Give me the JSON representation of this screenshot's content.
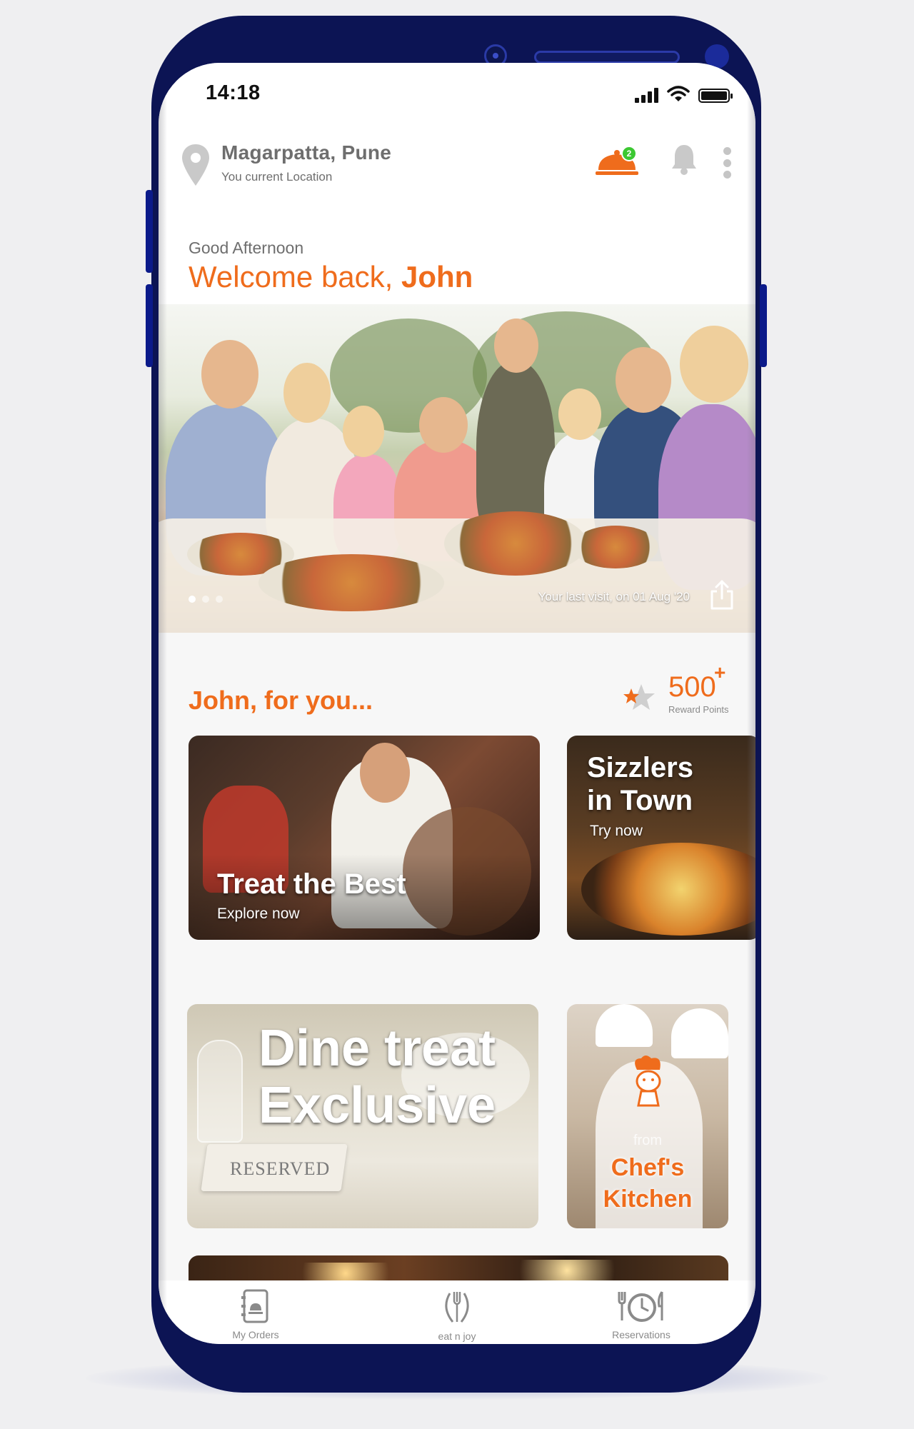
{
  "status_bar": {
    "time": "14:18"
  },
  "location": {
    "title": "Magarpatta, Pune",
    "subtitle": "You current Location"
  },
  "header": {
    "orders_badge": "2"
  },
  "greeting": {
    "line1": "Good Afternoon",
    "welcome_prefix": "Welcome back, ",
    "name": "John"
  },
  "hero": {
    "last_visit": "Your last visit, on 01 Aug '20",
    "dot_count": 3,
    "active_dot": 0
  },
  "section": {
    "title": "John, for you...",
    "points": "500",
    "points_plus": "+",
    "points_label": "Reward Points"
  },
  "cards": [
    {
      "title": "Treat the Best",
      "subtitle": "Explore now"
    },
    {
      "title_line1": "Sizzlers",
      "title_line2": "in Town",
      "subtitle": "Try now"
    },
    {
      "title_line1": "Dine treat",
      "title_line2": "Exclusive",
      "sign": "RESERVED"
    },
    {
      "from": "from",
      "line1": "Chef's",
      "line2": "Kitchen"
    }
  ],
  "bottom_nav": [
    {
      "label": "My Orders",
      "icon": "menu-book-icon"
    },
    {
      "label": "eat n joy",
      "icon": "utensils-icon"
    },
    {
      "label": "Reservations",
      "icon": "clock-cutlery-icon"
    }
  ],
  "colors": {
    "accent": "#ef6c1c",
    "phone_frame": "#0c1454",
    "badge": "#3cc832"
  }
}
